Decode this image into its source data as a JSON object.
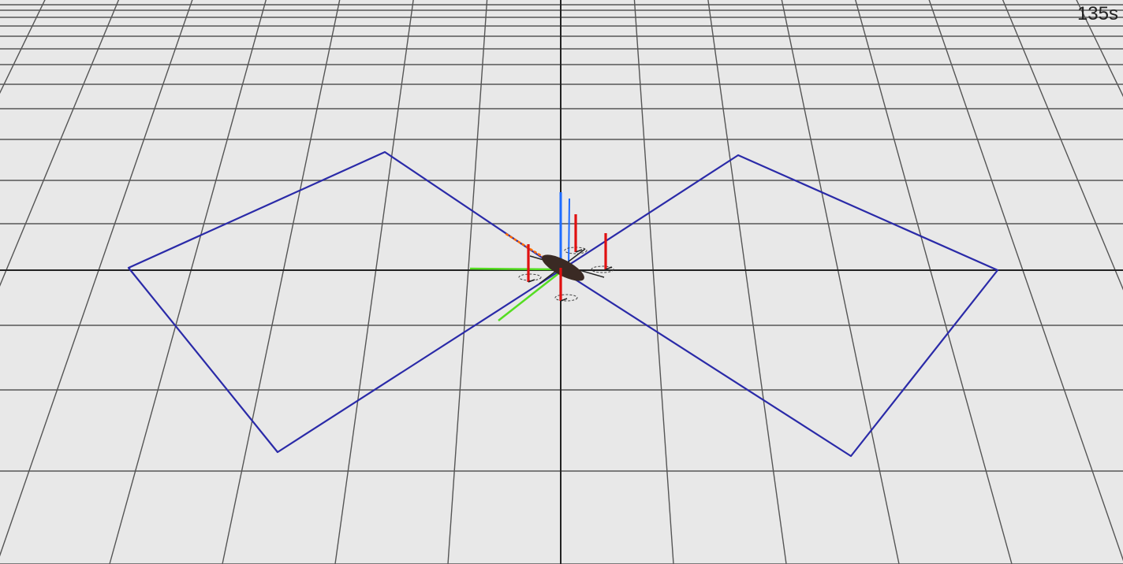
{
  "hud": {
    "sim_time": "135s"
  },
  "scene": {
    "background_color": "#e8e8e8",
    "grid_color": "#555555",
    "axis_line_color": "#222222",
    "trajectory_color": "#2a2aa8",
    "trajectory_shape": "figure-eight (two diamonds)",
    "vehicle": "quadrotor",
    "vehicle_color": "#3a2a24",
    "frame_axes_colors": {
      "x": "#ff6a00",
      "y": "#55dd22",
      "z": "#1e6bff"
    },
    "thrust_vector_color": "#e01010"
  }
}
